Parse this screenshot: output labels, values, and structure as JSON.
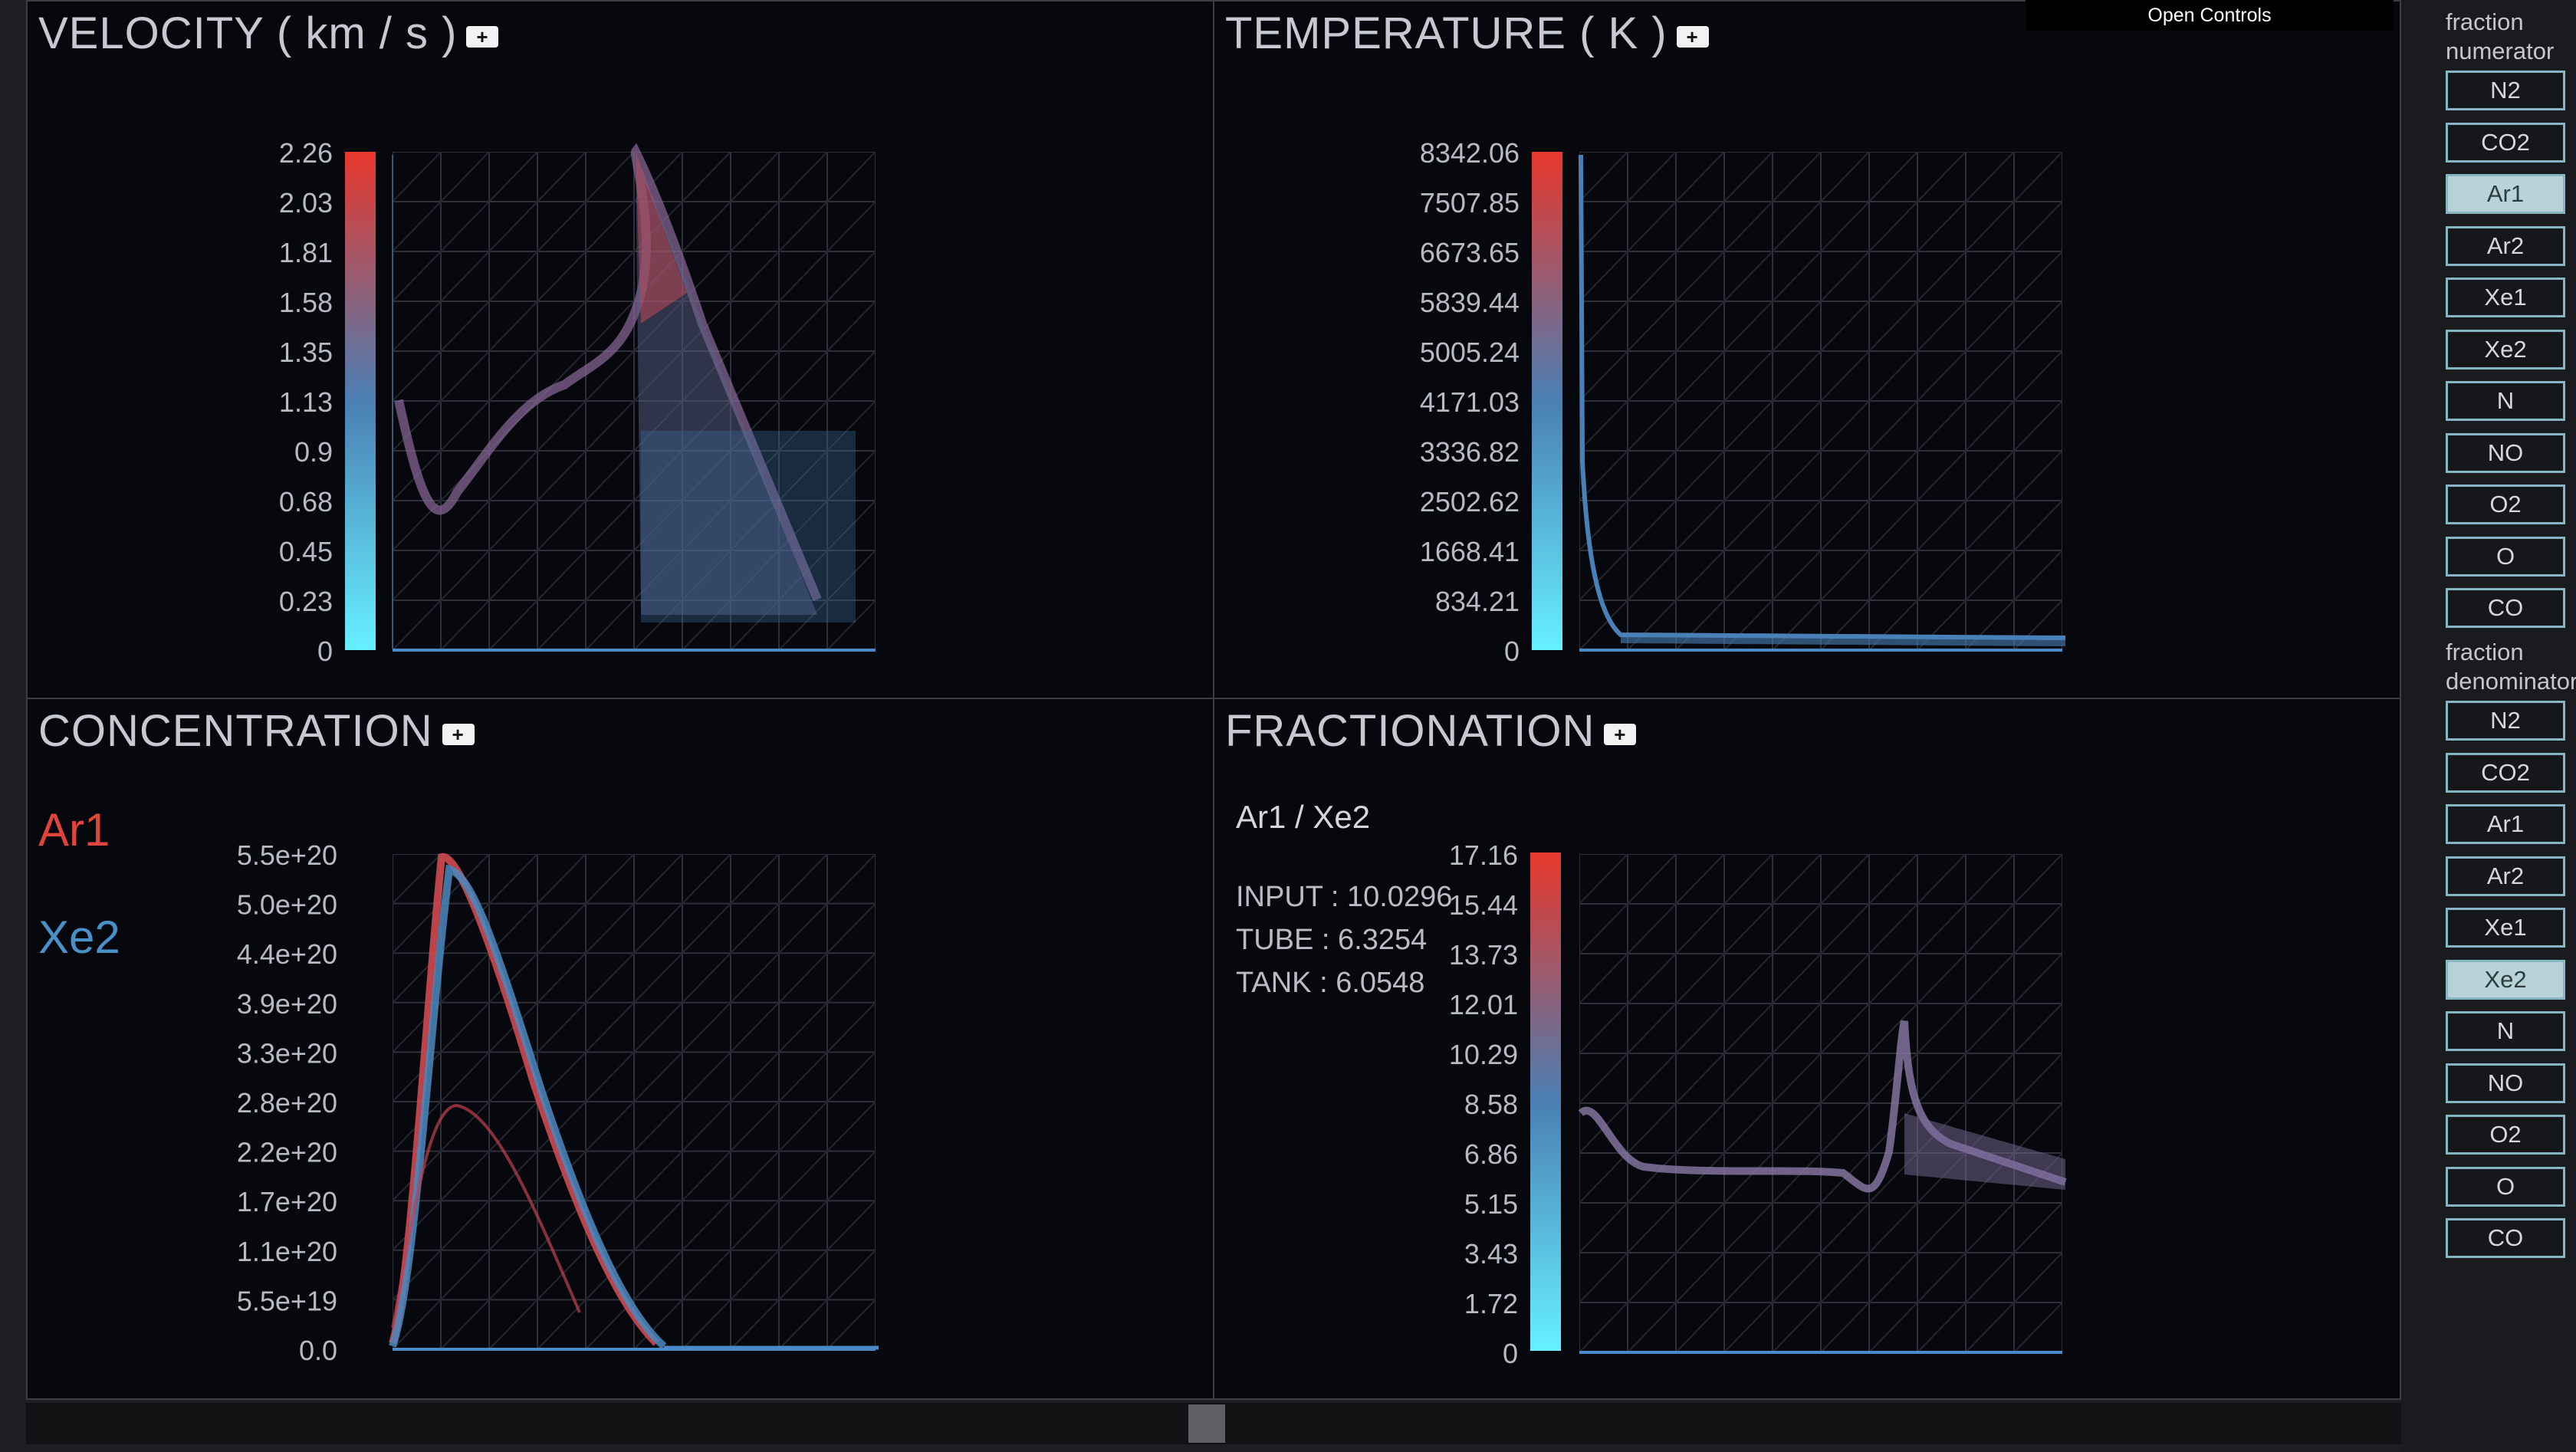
{
  "controls_button": "Open Controls",
  "plus_label": "+",
  "panels": {
    "velocity": {
      "title": "VELOCITY ( km / s )",
      "scale": [
        "2.26",
        "2.03",
        "1.81",
        "1.58",
        "1.35",
        "1.13",
        "0.9",
        "0.68",
        "0.45",
        "0.23",
        "0"
      ]
    },
    "temperature": {
      "title": "TEMPERATURE ( K )",
      "scale": [
        "8342.06",
        "7507.85",
        "6673.65",
        "5839.44",
        "5005.24",
        "4171.03",
        "3336.82",
        "2502.62",
        "1668.41",
        "834.21",
        "0"
      ]
    },
    "concentration": {
      "title": "CONCENTRATION",
      "scale": [
        "5.5e+20",
        "5.0e+20",
        "4.4e+20",
        "3.9e+20",
        "3.3e+20",
        "2.8e+20",
        "2.2e+20",
        "1.7e+20",
        "1.1e+20",
        "5.5e+19",
        "0.0"
      ],
      "legend": [
        "Ar1",
        "Xe2"
      ]
    },
    "fractionation": {
      "title": "FRACTIONATION",
      "scale": [
        "17.16",
        "15.44",
        "13.73",
        "12.01",
        "10.29",
        "8.58",
        "6.86",
        "5.15",
        "3.43",
        "1.72",
        "0"
      ],
      "ratio": "Ar1 / Xe2",
      "stats": [
        "INPUT : 10.0296",
        "TUBE : 6.3254",
        "TANK : 6.0548"
      ]
    }
  },
  "sidebar": {
    "numerator_label": [
      "fraction",
      "numerator"
    ],
    "denominator_label": [
      "fraction",
      "denominator"
    ],
    "species": [
      "N2",
      "CO2",
      "Ar1",
      "Ar2",
      "Xe1",
      "Xe2",
      "N",
      "NO",
      "O2",
      "O",
      "CO"
    ],
    "numerator_selected": "Ar1",
    "denominator_selected": "Xe2"
  },
  "colors": {
    "accent_red": "#e0443a",
    "accent_blue": "#4a90c8",
    "cyan": "#66f0ff",
    "button_border": "#86b6c2"
  }
}
